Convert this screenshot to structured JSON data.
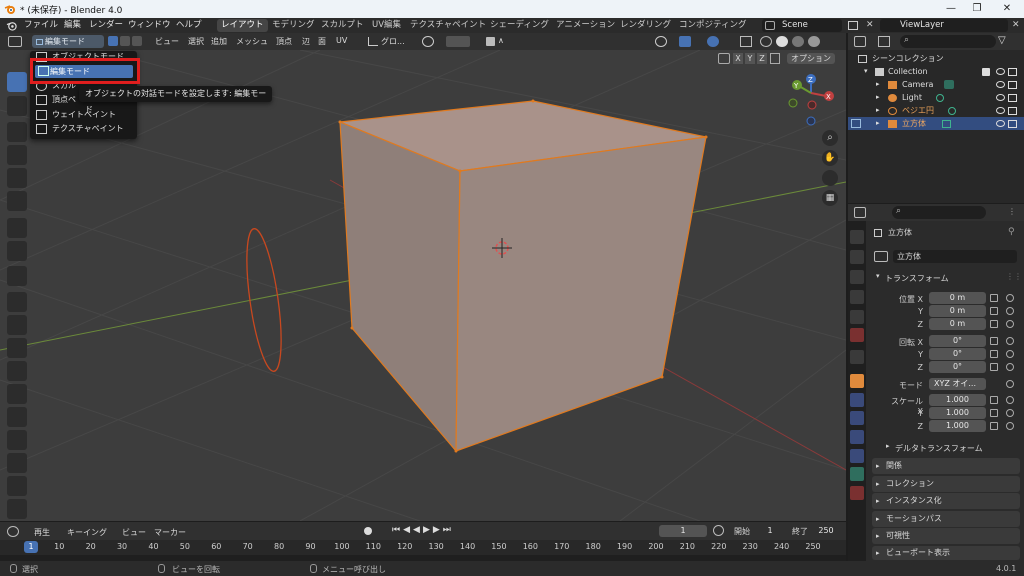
{
  "window": {
    "title": "* (未保存) - Blender 4.0",
    "controls": [
      "minimize-icon",
      "maximize-icon",
      "close-icon"
    ]
  },
  "menu": {
    "items": [
      "ファイル",
      "編集",
      "レンダー",
      "ウィンドウ",
      "ヘルプ"
    ],
    "workspaces": [
      "レイアウト",
      "モデリング",
      "スカルプト",
      "UV編集",
      "テクスチャペイント",
      "シェーディング",
      "アニメーション",
      "レンダリング",
      "コンポジティング"
    ],
    "active_workspace": "レイアウト",
    "scene": "Scene",
    "view_layer": "ViewLayer"
  },
  "viewport_header": {
    "mode": "編集モード",
    "menus": [
      "ビュー",
      "選択",
      "追加",
      "メッシュ",
      "頂点",
      "辺",
      "面",
      "UV"
    ],
    "transform_orientation": "グロ...",
    "options": "オプション",
    "axes": [
      "X",
      "Y",
      "Z"
    ]
  },
  "mode_dropdown": {
    "items": [
      "オブジェクトモード",
      "編集モード",
      "スカル",
      "頂点ペ",
      "ウェイトペイント",
      "テクスチャペイント"
    ],
    "selected": "編集モード",
    "tooltip": "オブジェクトの対話モードを設定します: 編集モード"
  },
  "gizmo": {
    "axes": [
      "X",
      "Y",
      "Z"
    ]
  },
  "outliner": {
    "root": "シーンコレクション",
    "collection": "Collection",
    "objects": [
      "Camera",
      "Light",
      "ベジエ円",
      "立方体"
    ],
    "selected": "立方体"
  },
  "properties": {
    "object_name": "立方体",
    "name_field": "立方体",
    "transform_label": "トランスフォーム",
    "location_label": "位置 X",
    "rotation_label": "回転 X",
    "scale_label": "スケール X",
    "axis_y": "Y",
    "axis_z": "Z",
    "location": [
      "0 m",
      "0 m",
      "0 m"
    ],
    "rotation": [
      "0°",
      "0°",
      "0°"
    ],
    "mode_label": "モード",
    "mode_value": "XYZ オイ...",
    "scale": [
      "1.000",
      "1.000",
      "1.000"
    ],
    "delta": "デルタトランスフォーム",
    "panels": [
      "関係",
      "コレクション",
      "インスタンス化",
      "モーションパス",
      "可視性",
      "ビューポート表示"
    ]
  },
  "timeline": {
    "menus": [
      "再生",
      "キーイング",
      "ビュー",
      "マーカー"
    ],
    "current_frame": "1",
    "start_label": "開始",
    "start": "1",
    "end_label": "終了",
    "end": "250",
    "ticks": [
      "1",
      "10",
      "20",
      "30",
      "40",
      "50",
      "60",
      "70",
      "80",
      "90",
      "100",
      "110",
      "120",
      "130",
      "140",
      "150",
      "160",
      "170",
      "180",
      "190",
      "200",
      "210",
      "220",
      "230",
      "240",
      "250"
    ]
  },
  "status": {
    "left": "選択",
    "middle": "ビューを回転",
    "right": "メニュー呼び出し",
    "version": "4.0.1"
  },
  "colors": {
    "accent": "#4772b3",
    "selection_orange": "#e07a1f",
    "highlight_red": "#e01e1e"
  }
}
